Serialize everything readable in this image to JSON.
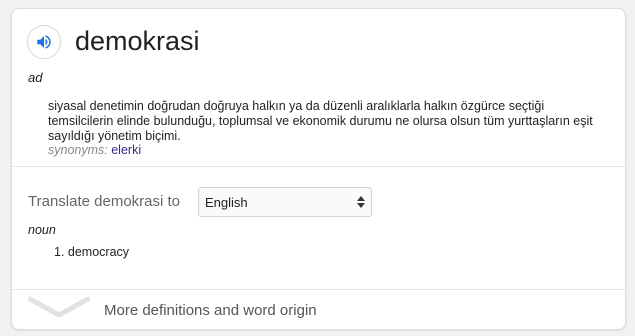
{
  "entry": {
    "word": "demokrasi",
    "part_of_speech": "ad",
    "definition": "siyasal denetimin doğrudan doğruya halkın ya da düzenli aralıklarla halkın özgürce seçtiği temsilcilerin elinde bulunduğu, toplumsal ve ekonomik durumu ne olursa olsun tüm yurttaşların eşit sayıldığı yönetim biçimi.",
    "synonyms_label": "synonyms:",
    "synonyms": [
      "elerki"
    ],
    "speaker_icon": "speaker-icon"
  },
  "translate": {
    "label": "Translate demokrasi to",
    "selected_language": "English",
    "part_of_speech": "noun",
    "items": [
      "1. democracy"
    ]
  },
  "footer": {
    "more_label": "More definitions and word origin",
    "expand_icon": "chevron-down-icon"
  },
  "colors": {
    "speaker_blue": "#1a73e8",
    "synonym_link": "#3c2289",
    "muted_label": "#878787"
  }
}
